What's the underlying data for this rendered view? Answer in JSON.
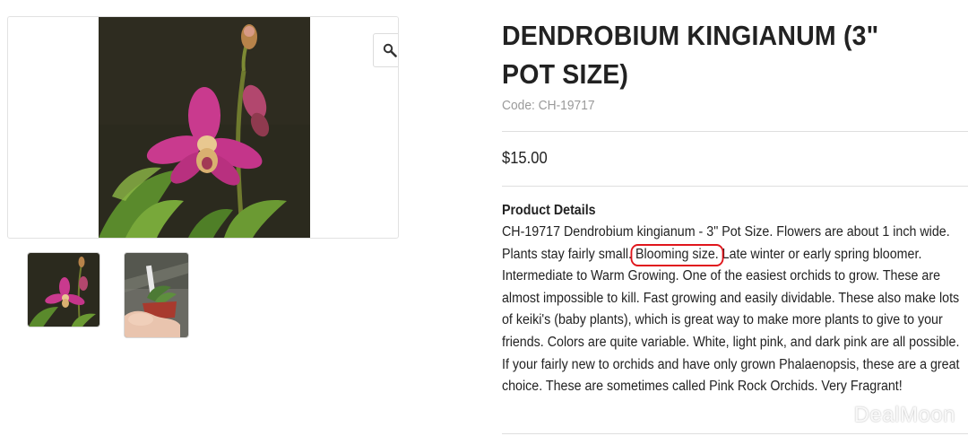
{
  "gallery": {
    "zoom_icon": "magnifier-icon",
    "thumbnails": [
      "orchid-flower-photo",
      "orchid-potted-in-hand-photo"
    ]
  },
  "product": {
    "title": "DENDROBIUM KINGIANUM (3\" POT SIZE)",
    "code": "Code: CH-19717",
    "price": "$15.00",
    "details_heading": "Product Details",
    "description_before": "CH-19717 Dendrobium kingianum - 3\" Pot Size. Flowers are about 1 inch wide. Plants stay fairly small. ",
    "description_highlight": "Blooming size.",
    "description_after": " Late winter or early spring bloomer. Intermediate to Warm Growing. One of the easiest orchids to grow. These are almost impossible to kill. Fast growing and easily dividable. These also make lots of keiki's (baby plants), which is great way to make more plants to give to your friends. Colors are quite variable. White, light pink, and dark pink are all possible. If your fairly new to orchids and have only grown Phalaenopsis, these are a great choice. These are sometimes called Pink Rock Orchids. Very Fragrant!"
  },
  "watermark": "DealMoon",
  "colors": {
    "highlight_circle": "#e0161c",
    "flower_pink": "#c93a8e",
    "photo_background": "#2b2a1e"
  }
}
